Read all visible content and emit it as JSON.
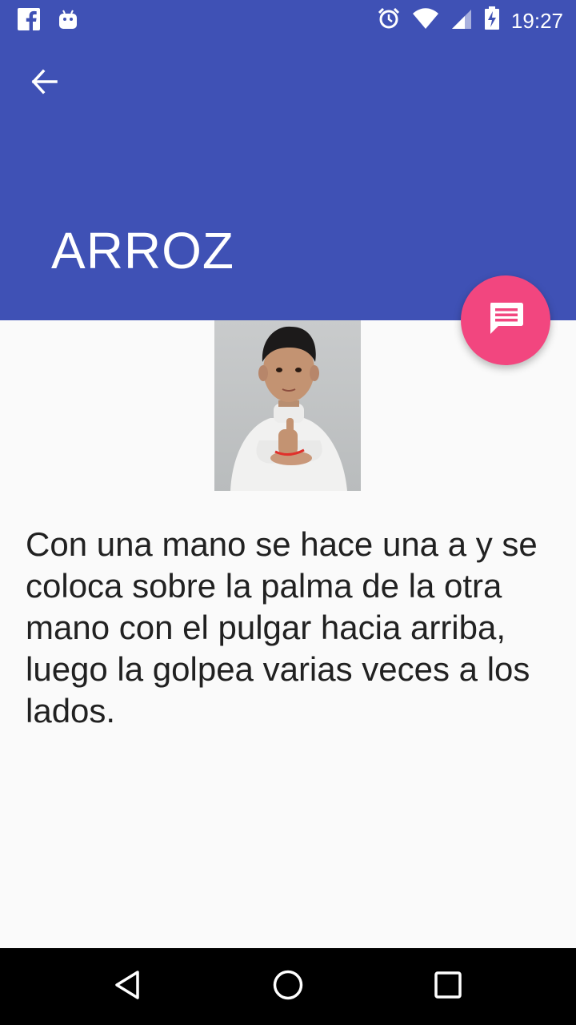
{
  "status_bar": {
    "time": "19:27",
    "left_icons": [
      "facebook-icon",
      "android-icon"
    ],
    "right_icons": [
      "alarm-icon",
      "wifi-icon",
      "signal-icon",
      "battery-charging-icon"
    ]
  },
  "app_bar": {
    "title": "ARROZ",
    "back_icon": "arrow-back-icon",
    "color": "#3f51b5"
  },
  "fab": {
    "icon": "chat-message-icon",
    "color": "#f2467f"
  },
  "content": {
    "image": "sign-language-photo",
    "description": "Con una mano se hace una a y se coloca sobre la palma de la otra mano con el pulgar hacia arriba, luego la golpea varias veces a los lados."
  },
  "nav_bar": {
    "buttons": [
      "back-triangle-icon",
      "home-circle-icon",
      "recents-square-icon"
    ]
  }
}
